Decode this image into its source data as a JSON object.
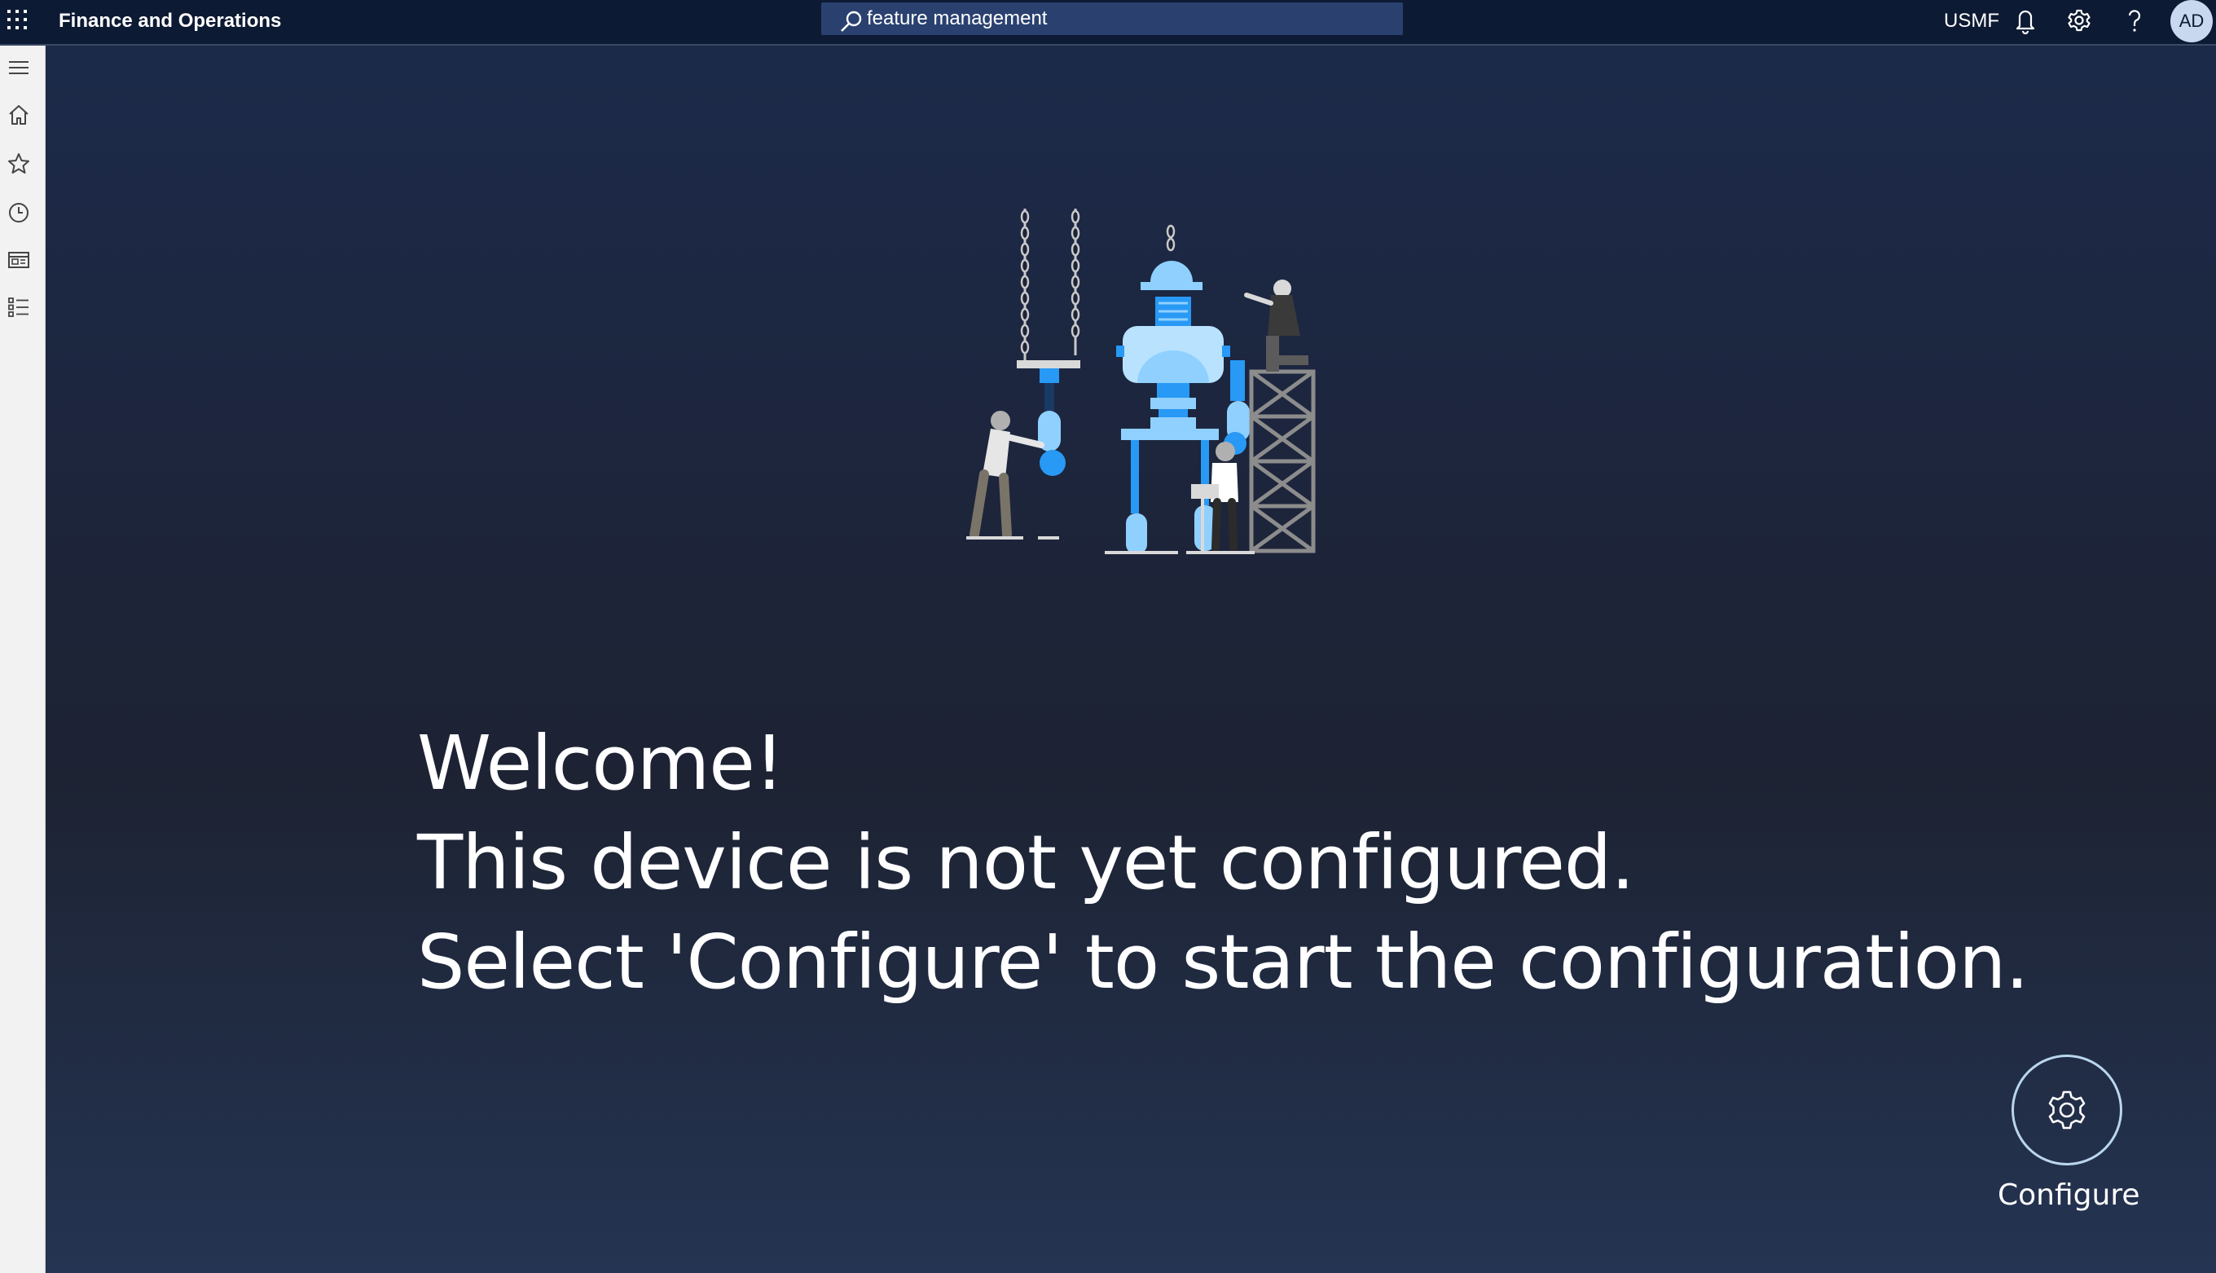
{
  "header": {
    "app_title": "Finance and Operations",
    "search": {
      "value": "feature management"
    },
    "company": "USMF",
    "avatar_initials": "AD",
    "icons": [
      "app-launcher-icon",
      "search-icon",
      "bell-icon",
      "gear-icon",
      "help-icon"
    ]
  },
  "nav": {
    "icons": [
      "hamburger-icon",
      "home-icon",
      "star-icon",
      "clock-icon",
      "workspace-icon",
      "list-icon"
    ]
  },
  "main": {
    "welcome_lines": [
      "Welcome!",
      "This device is not yet configured.",
      "Select 'Configure' to start the configuration."
    ],
    "configure_label": "Configure"
  },
  "colors": {
    "topbar": "#0d1a33",
    "search_bg": "#2a4170",
    "accent_light_blue": "#8fd0ff",
    "accent_blue": "#2899f5",
    "ring": "#b9d6ee"
  }
}
